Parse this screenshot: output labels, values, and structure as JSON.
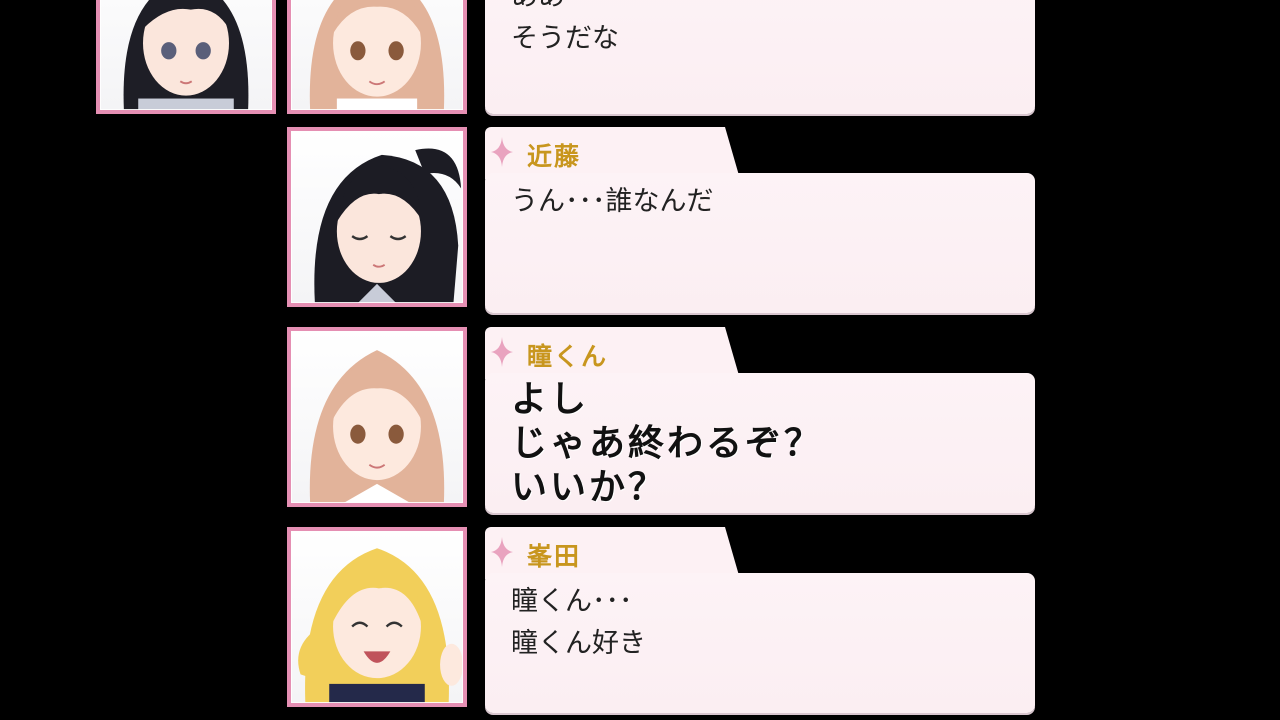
{
  "colors": {
    "background": "#000000",
    "portrait_border": "#e58fb3",
    "speaker_name": "#c8961e",
    "bubble": "#fdf1f4"
  },
  "log": [
    {
      "speaker": "",
      "lines": "ああ\nそうだな",
      "emphasis": false,
      "portraits": [
        "dark-hair-girl",
        "light-brown-hair-girl"
      ]
    },
    {
      "speaker": "近藤",
      "lines": "うん･･･誰なんだ",
      "emphasis": false,
      "portraits": [
        "dark-ponytail-girl-eyes-closed"
      ]
    },
    {
      "speaker": "瞳くん",
      "lines": "よし\nじゃあ終わるぞ？\nいいか？",
      "emphasis": true,
      "portraits": [
        "light-brown-hair-girl"
      ]
    },
    {
      "speaker": "峯田",
      "lines": "瞳くん･･･\n瞳くん好き",
      "emphasis": false,
      "portraits": [
        "blonde-girl-smiling"
      ]
    }
  ]
}
